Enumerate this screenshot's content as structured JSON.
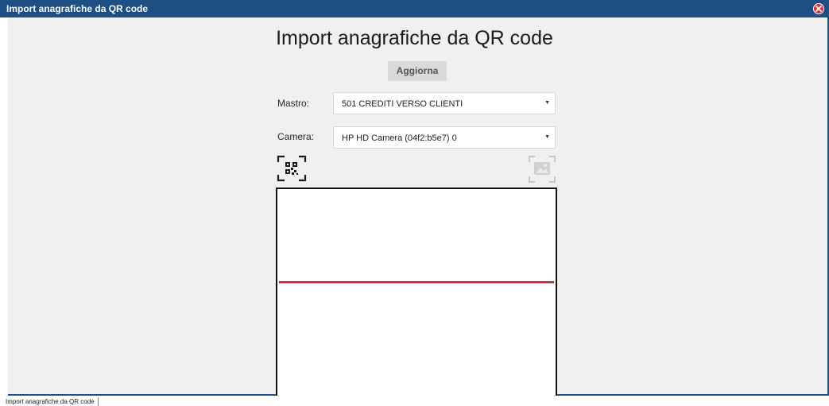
{
  "window": {
    "title": "Import anagrafiche da QR code",
    "close_icon": "close-icon"
  },
  "main": {
    "heading": "Import anagrafiche da QR code",
    "refresh_label": "Aggiorna",
    "mastro": {
      "label": "Mastro:",
      "selected": "501 CREDITI VERSO CLIENTI"
    },
    "camera": {
      "label": "Camera:",
      "selected": "HP HD Camera (04f2:b5e7) 0"
    },
    "icons": {
      "scan": "qr-scan-icon",
      "image": "image-scan-icon"
    }
  },
  "taskbar": {
    "tab_label": "Import anagrafiche da QR code"
  },
  "colors": {
    "titlebar": "#1d4e84",
    "background": "#f0f0f0",
    "scanline": "#b82b2b",
    "close": "#d9313a"
  }
}
